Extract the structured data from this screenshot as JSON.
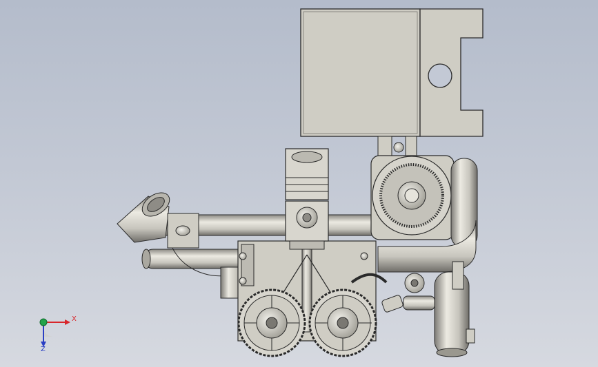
{
  "view": {
    "background_top": "#b4bccb",
    "background_bottom": "#d6d9e0",
    "part_fill": "#cfcdc4",
    "part_edge": "#2a2a2a"
  },
  "triad": {
    "x_label": "X",
    "z_label": "Z",
    "x_color": "#d8262b",
    "y_color": "#22a34a",
    "z_color": "#2a3fc4"
  }
}
